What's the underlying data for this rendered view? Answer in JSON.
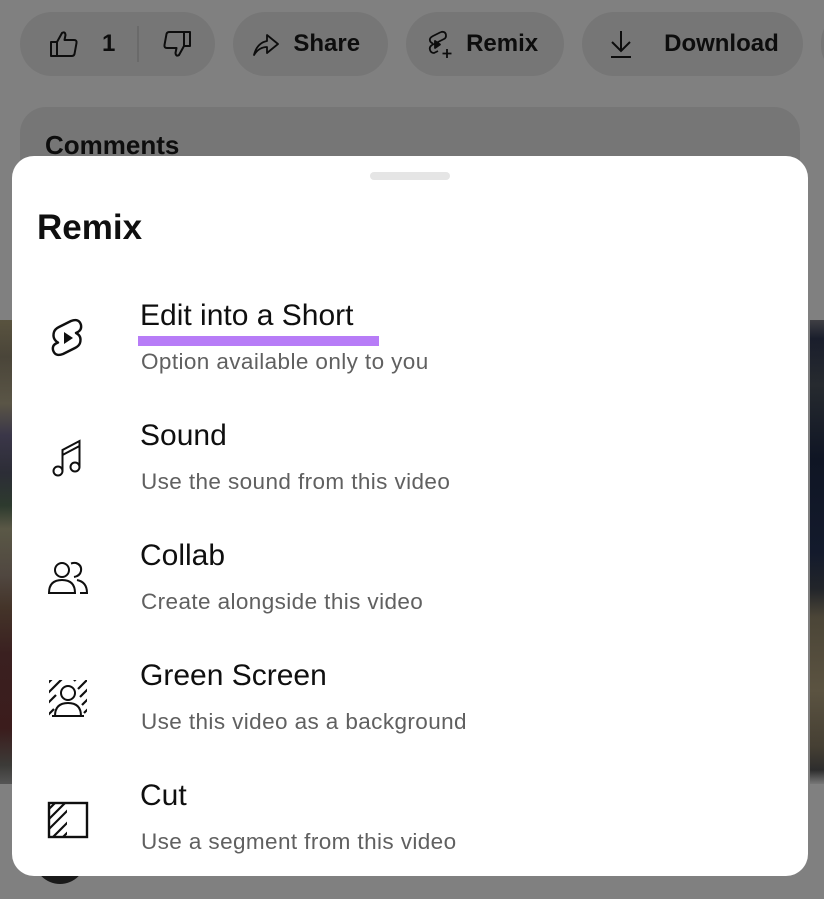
{
  "background_page": {
    "action_bar": {
      "like_count": "1",
      "like_icon": "thumbs-up-icon",
      "dislike_icon": "thumbs-down-icon",
      "share_label": "Share",
      "share_icon": "share-arrow-icon",
      "remix_label": "Remix",
      "remix_icon": "remix-icon",
      "download_label": "Download",
      "download_icon": "download-icon"
    },
    "comments_title": "Comments"
  },
  "remix_sheet": {
    "title": "Remix",
    "options": [
      {
        "label": "Edit into a Short",
        "subtitle": "Option available only to you",
        "icon": "shorts-icon",
        "highlighted": true,
        "highlight_color": "#b77cf7"
      },
      {
        "label": "Sound",
        "subtitle": "Use the sound from this video",
        "icon": "music-note-icon"
      },
      {
        "label": "Collab",
        "subtitle": "Create alongside this video",
        "icon": "people-icon"
      },
      {
        "label": "Green Screen",
        "subtitle": "Use this video as a background",
        "icon": "green-screen-icon"
      },
      {
        "label": "Cut",
        "subtitle": "Use a segment from this video",
        "icon": "cut-segment-icon"
      }
    ]
  },
  "colors": {
    "highlight": "#b77cf7",
    "overlay_dim": "#808080",
    "sheet_bg": "#ffffff",
    "subtitle_text": "#606060"
  }
}
